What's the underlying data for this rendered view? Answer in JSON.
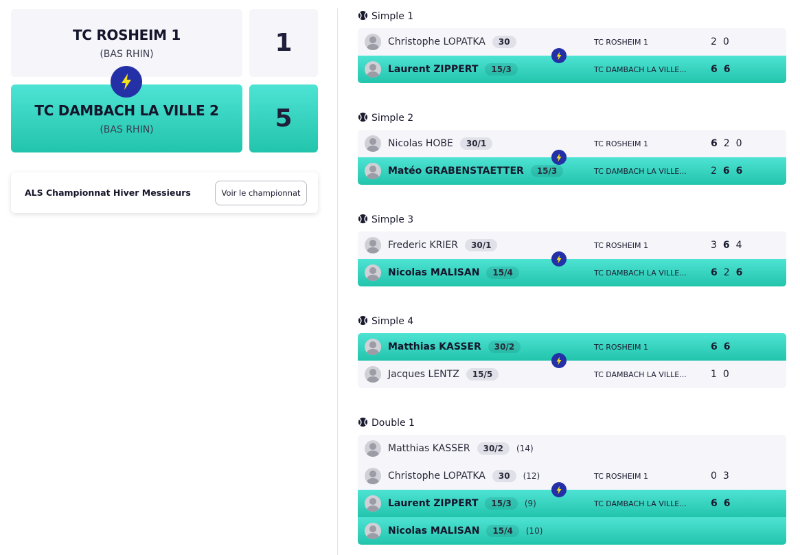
{
  "home_team": {
    "name": "TC ROSHEIM 1",
    "region": "(BAS RHIN)",
    "score": "1"
  },
  "away_team": {
    "name": "TC DAMBACH LA VILLE 2",
    "region": "(BAS RHIN)",
    "score": "5"
  },
  "championship": {
    "title": "ALS Championnat Hiver Messieurs",
    "button_label": "Voir le championnat"
  },
  "club_labels": {
    "home": "TC ROSHEIM 1",
    "away": "TC DAMBACH LA VILLE..."
  },
  "colors": {
    "accent_gradient_top": "#4ee3d4",
    "accent_gradient_bottom": "#22c4ac",
    "bolt": "#2430a6",
    "bolt_glyph": "#f5e21a",
    "panel": "#f5f5fa"
  },
  "icons": {
    "match": "tennis-ball-icon",
    "vs": "lightning-bolt-icon",
    "player": "avatar-icon"
  },
  "matches": [
    {
      "title": "Simple 1",
      "rows": [
        {
          "name": "Christophe LOPATKA",
          "rank": "30",
          "points": "",
          "club": "home",
          "win": false,
          "sets": [
            "2",
            "0"
          ],
          "set_wins": [
            false,
            false
          ]
        },
        {
          "name": "Laurent ZIPPERT",
          "rank": "15/3",
          "points": "",
          "club": "away",
          "win": true,
          "sets": [
            "6",
            "6"
          ],
          "set_wins": [
            true,
            true
          ]
        }
      ]
    },
    {
      "title": "Simple 2",
      "rows": [
        {
          "name": "Nicolas HOBE",
          "rank": "30/1",
          "points": "",
          "club": "home",
          "win": false,
          "sets": [
            "6",
            "2",
            "0"
          ],
          "set_wins": [
            true,
            false,
            false
          ]
        },
        {
          "name": "Matéo GRABENSTAETTER",
          "rank": "15/3",
          "points": "",
          "club": "away",
          "win": true,
          "sets": [
            "2",
            "6",
            "6"
          ],
          "set_wins": [
            false,
            true,
            true
          ]
        }
      ]
    },
    {
      "title": "Simple 3",
      "rows": [
        {
          "name": "Frederic KRIER",
          "rank": "30/1",
          "points": "",
          "club": "home",
          "win": false,
          "sets": [
            "3",
            "6",
            "4"
          ],
          "set_wins": [
            false,
            true,
            false
          ]
        },
        {
          "name": "Nicolas MALISAN",
          "rank": "15/4",
          "points": "",
          "club": "away",
          "win": true,
          "sets": [
            "6",
            "2",
            "6"
          ],
          "set_wins": [
            true,
            false,
            true
          ]
        }
      ]
    },
    {
      "title": "Simple 4",
      "rows": [
        {
          "name": "Matthias KASSER",
          "rank": "30/2",
          "points": "",
          "club": "home",
          "win": true,
          "sets": [
            "6",
            "6"
          ],
          "set_wins": [
            true,
            true
          ]
        },
        {
          "name": "Jacques LENTZ",
          "rank": "15/5",
          "points": "",
          "club": "away",
          "win": false,
          "sets": [
            "1",
            "0"
          ],
          "set_wins": [
            false,
            false
          ]
        }
      ]
    },
    {
      "title": "Double 1",
      "rows": [
        {
          "name": "Matthias KASSER",
          "rank": "30/2",
          "points": "(14)",
          "club": "",
          "win": false,
          "sets": [],
          "set_wins": []
        },
        {
          "name": "Christophe LOPATKA",
          "rank": "30",
          "points": "(12)",
          "club": "home",
          "win": false,
          "sets": [
            "0",
            "3"
          ],
          "set_wins": [
            false,
            false
          ]
        },
        {
          "name": "Laurent ZIPPERT",
          "rank": "15/3",
          "points": "(9)",
          "club": "away",
          "win": true,
          "sets": [
            "6",
            "6"
          ],
          "set_wins": [
            true,
            true
          ]
        },
        {
          "name": "Nicolas MALISAN",
          "rank": "15/4",
          "points": "(10)",
          "club": "",
          "win": true,
          "sets": [],
          "set_wins": []
        }
      ]
    }
  ]
}
